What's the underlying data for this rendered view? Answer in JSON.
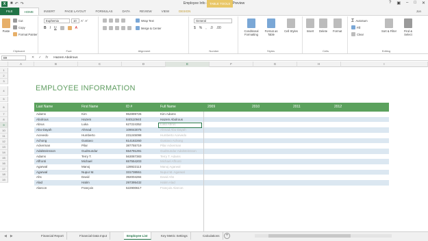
{
  "window": {
    "title": "Employee Info - Microsoft Excel Preview",
    "contextual_badge": "TABLE TOOLS",
    "signin": "Jon"
  },
  "tabs": [
    "FILE",
    "HOME",
    "INSERT",
    "PAGE LAYOUT",
    "FORMULAS",
    "DATA",
    "REVIEW",
    "VIEW",
    "DESIGN"
  ],
  "ribbon": {
    "clipboard": {
      "paste": "Paste",
      "cut": "Cut",
      "copy": "Copy",
      "format_painter": "Format Painter",
      "label": "Clipboard"
    },
    "font": {
      "name": "Euphemia",
      "size": "10",
      "label": "Font"
    },
    "alignment": {
      "wrap": "Wrap Text",
      "merge": "Merge & Center",
      "label": "Alignment"
    },
    "number": {
      "format": "General",
      "label": "Number"
    },
    "styles": {
      "conditional": "Conditional Formatting",
      "format_table": "Format as Table",
      "cell_styles": "Cell Styles",
      "label": "Styles"
    },
    "cells": {
      "insert": "Insert",
      "delete": "Delete",
      "format": "Format",
      "label": "Cells"
    },
    "editing": {
      "autosum": "AutoSum",
      "fill": "Fill",
      "clear": "Clear",
      "sort": "Sort & Filter",
      "find": "Find & Select",
      "label": "Editing"
    }
  },
  "formula_bar": {
    "name_box": "B9",
    "content": "Hazem Abolrous"
  },
  "columns": [
    "A",
    "B",
    "C",
    "D",
    "E",
    "F",
    "G",
    "H",
    "I"
  ],
  "rows": [
    "1",
    "2",
    "3",
    "4",
    "5",
    "6",
    "7",
    "8",
    "9",
    "10",
    "11",
    "12",
    "13",
    "14",
    "15",
    "16",
    "17",
    "18",
    "19"
  ],
  "sheet_title": "EMPLOYEE INFORMATION",
  "table": {
    "headers": [
      "Last Name",
      "First Name",
      "ID #",
      "Full Name",
      "2009",
      "2010",
      "2011",
      "2012"
    ],
    "rows": [
      [
        "Adams",
        "Kim",
        "962899726",
        "Kim Adams"
      ],
      [
        "Abolrous",
        "Hazem",
        "840110940",
        "Hazem Abolrous"
      ],
      [
        "Abrus",
        "Luka",
        "627224352",
        "Luka Abrus"
      ],
      [
        "Abu-Dayah",
        "Ahmad",
        "109043075",
        "Ahmad Abu-Dayah"
      ],
      [
        "Acevedo",
        "Humberto",
        "231245098",
        "Humberto Acevedo"
      ],
      [
        "Achong",
        "Gustavo",
        "614182260",
        "Gustavo Achong"
      ],
      [
        "Ackerman",
        "Pilar",
        "387755719",
        "Pilar Ackerman"
      ],
      [
        "Adalsteinsson",
        "Gudmundur",
        "554791291",
        "Gudmundur Adalsteinsson"
      ],
      [
        "Adams",
        "Terry T.",
        "563087383",
        "Terry T. Adams"
      ],
      [
        "Affronti",
        "Michael",
        "657554203",
        "Michael Affronti"
      ],
      [
        "Agarwal",
        "Manoj",
        "128922113",
        "Manoj Agarwal"
      ],
      [
        "Agarwal",
        "Nupur M.",
        "331738551",
        "Nupur M. Agarwal"
      ],
      [
        "Ahs",
        "David",
        "392004284",
        "David Ahs"
      ],
      [
        "Alad",
        "Hatim",
        "297395432",
        "Hatim Alad"
      ],
      [
        "Alarcon",
        "François",
        "522900617",
        "François Alarcon"
      ]
    ]
  },
  "sheet_tabs": [
    "Financial Report",
    "Financial Data Input",
    "Employee List",
    "Key Metric Settings",
    "Calculations"
  ],
  "active_sheet": "Employee List"
}
